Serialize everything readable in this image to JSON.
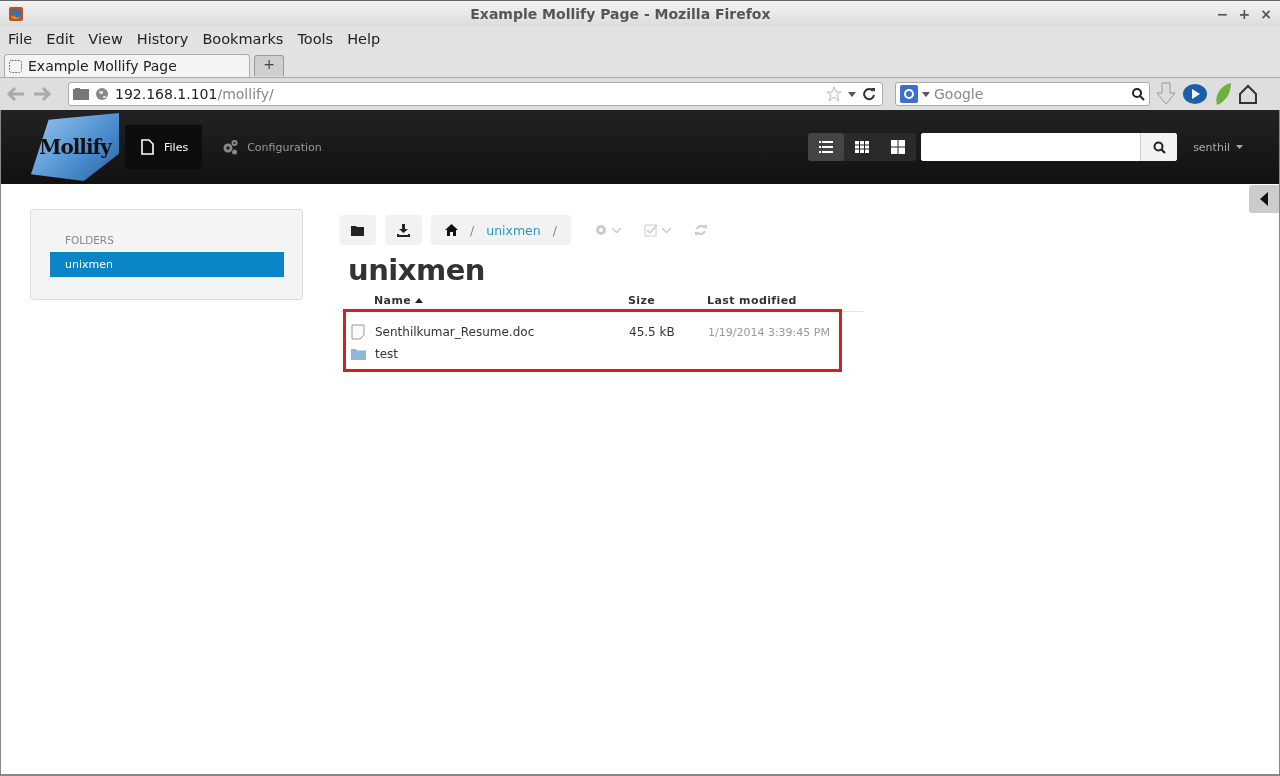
{
  "window": {
    "title": "Example Mollify Page - Mozilla Firefox",
    "controls": [
      "−",
      "+",
      "×"
    ]
  },
  "menu": [
    "File",
    "Edit",
    "View",
    "History",
    "Bookmarks",
    "Tools",
    "Help"
  ],
  "tabs": [
    {
      "label": "Example Mollify Page",
      "selected": true
    }
  ],
  "new_tab": "+",
  "address_bar": {
    "host": "192.168.1.101",
    "path": "/mollify/"
  },
  "search_engine": {
    "placeholder": "Google"
  },
  "app": {
    "logo": "Mollify",
    "nav": [
      {
        "label": "Files",
        "kind": "files",
        "selected": true
      },
      {
        "label": "Configuration",
        "kind": "config",
        "selected": false
      }
    ],
    "view_modes": [
      {
        "kind": "list",
        "selected": true
      },
      {
        "kind": "small-grid",
        "selected": false
      },
      {
        "kind": "large-grid",
        "selected": false
      }
    ],
    "user": "senthil"
  },
  "sidebar": {
    "heading": "FOLDERS",
    "items": [
      {
        "label": "unixmen",
        "selected": true
      }
    ]
  },
  "toolbar": {
    "breadcrumb": [
      "unixmen"
    ],
    "separator": "/",
    "actions": [
      {
        "kind": "settings",
        "disabled": true
      },
      {
        "kind": "select",
        "disabled": true
      },
      {
        "kind": "refresh",
        "disabled": true
      }
    ]
  },
  "folder_title": "unixmen",
  "file_list": {
    "highlighted": true,
    "columns": [
      {
        "label": "Name",
        "sorted": true
      },
      {
        "label": "Size",
        "sorted": false
      },
      {
        "label": "Last modified",
        "sorted": false
      }
    ],
    "rows": [
      {
        "kind": "file",
        "name": "Senthilkumar_Resume.doc",
        "size": "45.5 kB",
        "modified": "1/19/2014 3:39:45 PM"
      },
      {
        "kind": "folder",
        "name": "test"
      }
    ]
  }
}
